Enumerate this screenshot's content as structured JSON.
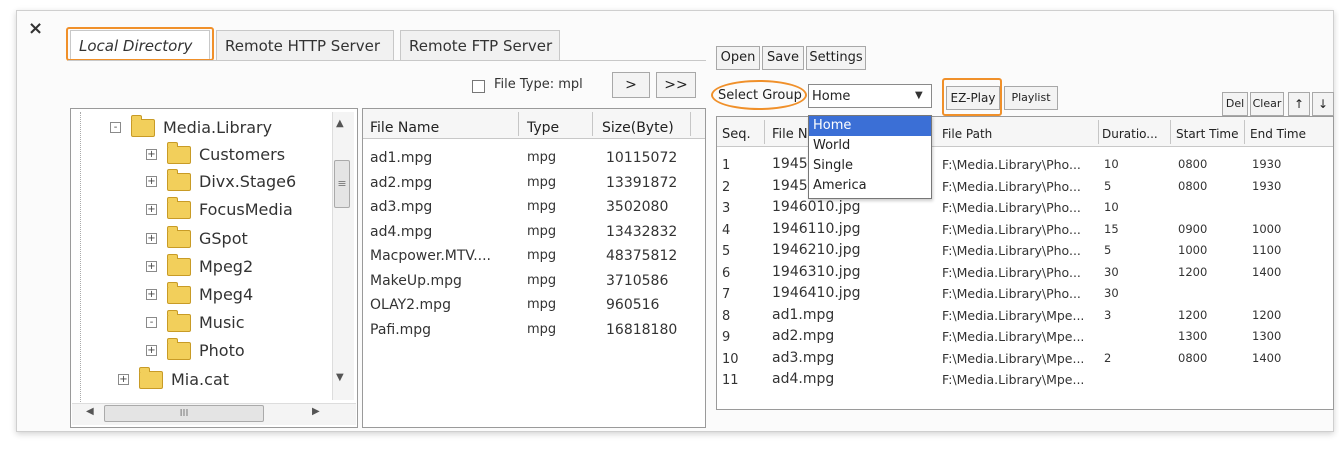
{
  "close_label": "×",
  "tabs": [
    {
      "label": "Local Directory"
    },
    {
      "label": "Remote HTTP Server"
    },
    {
      "label": "Remote FTP Server"
    }
  ],
  "filter": {
    "label": "File Type: mpl",
    "next": ">",
    "all": ">>"
  },
  "tree": {
    "items": [
      {
        "label": "Media.Library",
        "sign": "-"
      },
      {
        "label": "Customers",
        "sign": "+"
      },
      {
        "label": "Divx.Stage6",
        "sign": "+"
      },
      {
        "label": "FocusMedia",
        "sign": "+"
      },
      {
        "label": "GSpot",
        "sign": "+"
      },
      {
        "label": "Mpeg2",
        "sign": "+"
      },
      {
        "label": "Mpeg4",
        "sign": "+"
      },
      {
        "label": "Music",
        "sign": "-"
      },
      {
        "label": "Photo",
        "sign": "+"
      },
      {
        "label": "Mia.cat",
        "sign": "+"
      }
    ],
    "scroll_thumb": "III"
  },
  "files": {
    "columns": [
      "File Name",
      "Type",
      "Size(Byte)"
    ],
    "rows": [
      [
        "ad1.mpg",
        "mpg",
        "10115072"
      ],
      [
        "ad2.mpg",
        "mpg",
        "13391872"
      ],
      [
        "ad3.mpg",
        "mpg",
        "3502080"
      ],
      [
        "ad4.mpg",
        "mpg",
        "13432832"
      ],
      [
        "Macpower.MTV....",
        "mpg",
        "48375812"
      ],
      [
        "MakeUp.mpg",
        "mpg",
        "3710586"
      ],
      [
        "OLAY2.mpg",
        "mpg",
        "960516"
      ],
      [
        "Pafi.mpg",
        "mpg",
        "16818180"
      ]
    ]
  },
  "toolbar": {
    "open": "Open",
    "save": "Save",
    "settings": "Settings"
  },
  "group": {
    "label": "Select Group",
    "selected": "Home",
    "options": [
      "Home",
      "World",
      "Single",
      "America"
    ]
  },
  "actions": {
    "ezplay": "EZ-Play",
    "playlist": "Playlist",
    "del": "Del",
    "clear": "Clear",
    "up": "↑",
    "down": "↓"
  },
  "playlist": {
    "columns": [
      "Seq.",
      "File N",
      "File Path",
      "Duratio...",
      "Start Time",
      "End Time"
    ],
    "rows": [
      {
        "seq": "1",
        "file": "1945",
        "path": "F:\\Media.Library\\Pho...",
        "dur": "10",
        "start": "0800",
        "end": "1930"
      },
      {
        "seq": "2",
        "file": "1945",
        "path": "F:\\Media.Library\\Pho...",
        "dur": "5",
        "start": "0800",
        "end": "1930"
      },
      {
        "seq": "3",
        "file": "1946010.jpg",
        "path": "F:\\Media.Library\\Pho...",
        "dur": "10",
        "start": "",
        "end": ""
      },
      {
        "seq": "4",
        "file": "1946110.jpg",
        "path": "F:\\Media.Library\\Pho...",
        "dur": "15",
        "start": "0900",
        "end": "1000"
      },
      {
        "seq": "5",
        "file": "1946210.jpg",
        "path": "F:\\Media.Library\\Pho...",
        "dur": "5",
        "start": "1000",
        "end": "1100"
      },
      {
        "seq": "6",
        "file": "1946310.jpg",
        "path": "F:\\Media.Library\\Pho...",
        "dur": "30",
        "start": "1200",
        "end": "1400"
      },
      {
        "seq": "7",
        "file": "1946410.jpg",
        "path": "F:\\Media.Library\\Pho...",
        "dur": "30",
        "start": "",
        "end": ""
      },
      {
        "seq": "8",
        "file": "ad1.mpg",
        "path": "F:\\Media.Library\\Mpe...",
        "dur": "3",
        "start": "1200",
        "end": "1200"
      },
      {
        "seq": "9",
        "file": "ad2.mpg",
        "path": "F:\\Media.Library\\Mpe...",
        "dur": "",
        "start": "1300",
        "end": "1300"
      },
      {
        "seq": "10",
        "file": "ad3.mpg",
        "path": "F:\\Media.Library\\Mpe...",
        "dur": "2",
        "start": "0800",
        "end": "1400"
      },
      {
        "seq": "11",
        "file": "ad4.mpg",
        "path": "F:\\Media.Library\\Mpe...",
        "dur": "",
        "start": "",
        "end": ""
      }
    ]
  },
  "colors": {
    "highlight": "#f0902a",
    "selection": "#3b6fd6"
  }
}
